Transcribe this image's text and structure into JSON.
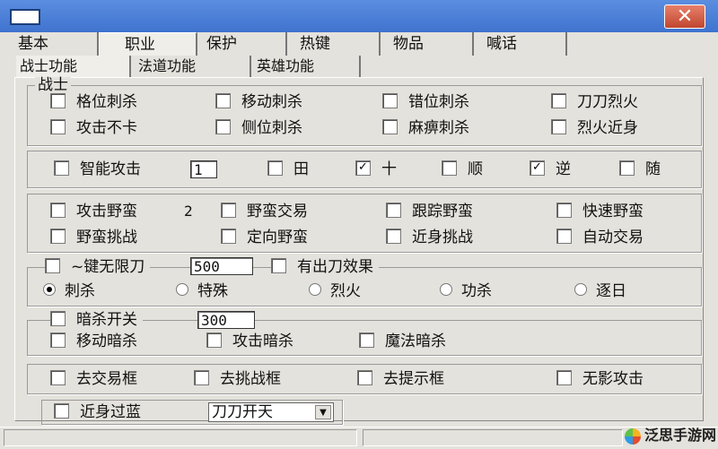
{
  "window": {
    "close_glyph": "✕"
  },
  "tabs_main": [
    "基本",
    "职业",
    "保护",
    "热键",
    "物品",
    "喊话"
  ],
  "tabs_sub": [
    "战士功能",
    "法道功能",
    "英雄功能"
  ],
  "warrior": {
    "title": "战士",
    "row1": [
      "格位刺杀",
      "移动刺杀",
      "错位刺杀",
      "刀刀烈火"
    ],
    "row2": [
      "攻击不卡",
      "侧位刺杀",
      "麻痹刺杀",
      "烈火近身"
    ]
  },
  "smart_attack": {
    "label": "智能攻击",
    "value": "1",
    "options": [
      {
        "label": "田",
        "checked": false
      },
      {
        "label": "十",
        "checked": true
      },
      {
        "label": "顺",
        "checked": false
      },
      {
        "label": "逆",
        "checked": true
      },
      {
        "label": "随",
        "checked": false
      }
    ]
  },
  "savage": {
    "row1": [
      "攻击野蛮",
      "野蛮交易",
      "跟踪野蛮",
      "快速野蛮"
    ],
    "value": "2",
    "row2": [
      "野蛮挑战",
      "定向野蛮",
      "近身挑战",
      "自动交易"
    ]
  },
  "blade": {
    "label": "~键无限刀",
    "value": "500",
    "effect_label": "有出刀效果",
    "radios": [
      {
        "label": "刺杀",
        "selected": true
      },
      {
        "label": "特殊",
        "selected": false
      },
      {
        "label": "烈火",
        "selected": false
      },
      {
        "label": "功杀",
        "selected": false
      },
      {
        "label": "逐日",
        "selected": false
      }
    ]
  },
  "assassin": {
    "label": "暗杀开关",
    "value": "300",
    "options": [
      "移动暗杀",
      "攻击暗杀",
      "魔法暗杀"
    ]
  },
  "remove": [
    "去交易框",
    "去挑战框",
    "去提示框",
    "无影攻击"
  ],
  "bottom": {
    "label": "近身过蓝",
    "select_value": "刀刀开天"
  },
  "watermark": "泛思手游网"
}
